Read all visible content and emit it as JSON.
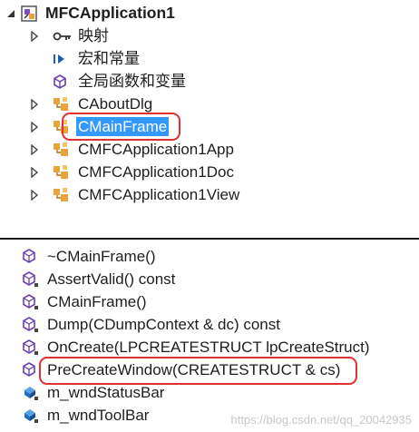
{
  "tree": {
    "root": {
      "label": "MFCApplication1"
    },
    "items": [
      {
        "label": "映射",
        "icon": "map-icon",
        "expander": true
      },
      {
        "label": "宏和常量",
        "icon": "macro-icon",
        "expander": false
      },
      {
        "label": "全局函数和变量",
        "icon": "global-icon",
        "expander": false
      },
      {
        "label": "CAboutDlg",
        "icon": "class-icon",
        "expander": true
      },
      {
        "label": "CMainFrame",
        "icon": "class-icon",
        "expander": true,
        "selected": true
      },
      {
        "label": "CMFCApplication1App",
        "icon": "class-icon",
        "expander": true
      },
      {
        "label": "CMFCApplication1Doc",
        "icon": "class-icon",
        "expander": true
      },
      {
        "label": "CMFCApplication1View",
        "icon": "class-icon",
        "expander": true
      }
    ]
  },
  "members": {
    "items": [
      {
        "label": "~CMainFrame()",
        "icon": "method-icon"
      },
      {
        "label": "AssertValid() const",
        "icon": "method-protected-icon"
      },
      {
        "label": "CMainFrame()",
        "icon": "method-protected-icon"
      },
      {
        "label": "Dump(CDumpContext & dc) const",
        "icon": "method-protected-icon"
      },
      {
        "label": "OnCreate(LPCREATESTRUCT lpCreateStruct)",
        "icon": "method-protected-icon"
      },
      {
        "label": "PreCreateWindow(CREATESTRUCT & cs)",
        "icon": "method-icon"
      },
      {
        "label": "m_wndStatusBar",
        "icon": "field-protected-icon"
      },
      {
        "label": "m_wndToolBar",
        "icon": "field-protected-icon"
      }
    ]
  },
  "colors": {
    "selection": "#3399ff",
    "highlight_ring": "#e03030",
    "method_purple": "#6c3fb5",
    "class_orange": "#e8a33a",
    "field_blue": "#1f6fc1"
  },
  "watermark": "https://blog.csdn.net/qq_20042935"
}
